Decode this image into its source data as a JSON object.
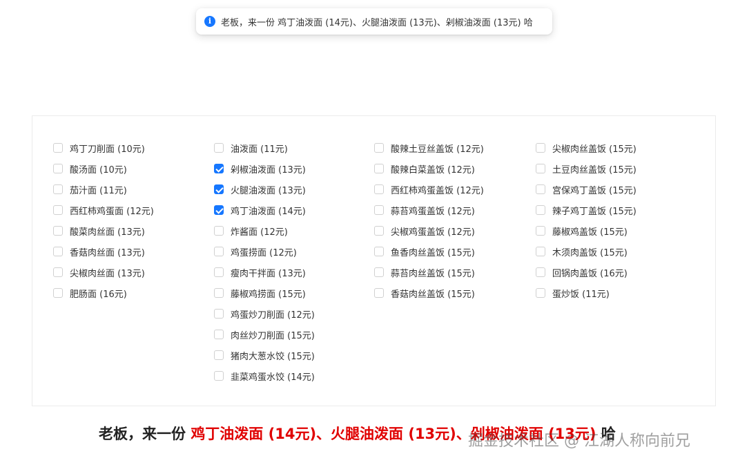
{
  "message": {
    "icon": "info-icon",
    "text": "老板，来一份 鸡丁油泼面 (14元)、火腿油泼面 (13元)、剁椒油泼面 (13元) 哈"
  },
  "columns": [
    [
      {
        "label": "鸡丁刀削面 (10元)",
        "checked": false
      },
      {
        "label": "酸汤面 (10元)",
        "checked": false
      },
      {
        "label": "茄汁面 (11元)",
        "checked": false
      },
      {
        "label": "西红柿鸡蛋面 (12元)",
        "checked": false
      },
      {
        "label": "酸菜肉丝面 (13元)",
        "checked": false
      },
      {
        "label": "香菇肉丝面 (13元)",
        "checked": false
      },
      {
        "label": "尖椒肉丝面 (13元)",
        "checked": false
      },
      {
        "label": "肥肠面 (16元)",
        "checked": false
      }
    ],
    [
      {
        "label": "油泼面 (11元)",
        "checked": false
      },
      {
        "label": "剁椒油泼面 (13元)",
        "checked": true
      },
      {
        "label": "火腿油泼面 (13元)",
        "checked": true
      },
      {
        "label": "鸡丁油泼面 (14元)",
        "checked": true
      },
      {
        "label": "炸酱面 (12元)",
        "checked": false
      },
      {
        "label": "鸡蛋捞面 (12元)",
        "checked": false
      },
      {
        "label": "瘦肉干拌面 (13元)",
        "checked": false
      },
      {
        "label": "藤椒鸡捞面 (15元)",
        "checked": false
      },
      {
        "label": "鸡蛋炒刀削面 (12元)",
        "checked": false
      },
      {
        "label": "肉丝炒刀削面 (15元)",
        "checked": false
      },
      {
        "label": "猪肉大葱水饺 (15元)",
        "checked": false
      },
      {
        "label": "韭菜鸡蛋水饺 (14元)",
        "checked": false
      }
    ],
    [
      {
        "label": "酸辣土豆丝盖饭 (12元)",
        "checked": false
      },
      {
        "label": "酸辣白菜盖饭 (12元)",
        "checked": false
      },
      {
        "label": "西红柿鸡蛋盖饭 (12元)",
        "checked": false
      },
      {
        "label": "蒜苔鸡蛋盖饭 (12元)",
        "checked": false
      },
      {
        "label": "尖椒鸡蛋盖饭 (12元)",
        "checked": false
      },
      {
        "label": "鱼香肉丝盖饭 (15元)",
        "checked": false
      },
      {
        "label": "蒜苔肉丝盖饭 (15元)",
        "checked": false
      },
      {
        "label": "香菇肉丝盖饭 (15元)",
        "checked": false
      }
    ],
    [
      {
        "label": "尖椒肉丝盖饭 (15元)",
        "checked": false
      },
      {
        "label": "土豆肉丝盖饭 (15元)",
        "checked": false
      },
      {
        "label": "宫保鸡丁盖饭 (15元)",
        "checked": false
      },
      {
        "label": "辣子鸡丁盖饭 (15元)",
        "checked": false
      },
      {
        "label": "藤椒鸡盖饭 (15元)",
        "checked": false
      },
      {
        "label": "木须肉盖饭 (15元)",
        "checked": false
      },
      {
        "label": "回锅肉盖饭 (16元)",
        "checked": false
      },
      {
        "label": "蛋炒饭 (11元)",
        "checked": false
      }
    ]
  ],
  "summary": {
    "prefix": "老板，来一份 ",
    "picked": "鸡丁油泼面 (14元)、火腿油泼面 (13元)、剁椒油泼面 (13元)",
    "suffix": " 哈"
  },
  "watermark": "掘金技术社区 @ 江湖人称向前兄",
  "colors": {
    "accent": "#1677ff",
    "highlight": "#e00000"
  }
}
